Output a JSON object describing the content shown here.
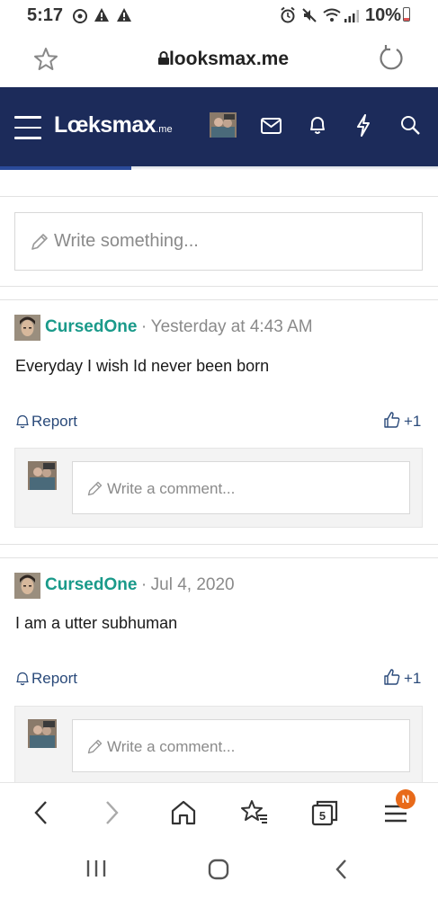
{
  "status": {
    "time": "5:17",
    "battery": "10%"
  },
  "browser": {
    "url": "looksmax.me",
    "tab_count": "5",
    "menu_badge": "N"
  },
  "site": {
    "logo_main": "Lœksmax",
    "logo_suffix": ".me"
  },
  "composer": {
    "placeholder": "Write something..."
  },
  "posts": [
    {
      "author": "CursedOne",
      "separator": "·",
      "time": "Yesterday at 4:43 AM",
      "text": "Everyday I wish Id never been born",
      "report": "Report",
      "likes": "+1",
      "comment_placeholder": "Write a comment..."
    },
    {
      "author": "CursedOne",
      "separator": "·",
      "time": "Jul 4, 2020",
      "text": "I am a utter subhuman",
      "report": "Report",
      "likes": "+1",
      "comment_placeholder": "Write a comment..."
    }
  ],
  "colors": {
    "header_bg": "#1c2b5a",
    "author": "#1a9a8a",
    "link": "#2a4a7a",
    "badge": "#e86a1a"
  },
  "icons": [
    "alarm-icon",
    "warning-icon",
    "mute-icon",
    "wifi-icon",
    "signal-icon",
    "battery-icon",
    "star-icon",
    "lock-icon",
    "reload-icon",
    "hamburger-icon",
    "mail-icon",
    "bell-icon",
    "bolt-icon",
    "search-icon",
    "pencil-icon",
    "thumbs-up-icon",
    "back-icon",
    "forward-icon",
    "home-icon",
    "bookmarks-icon",
    "tabs-icon",
    "menu-icon"
  ]
}
